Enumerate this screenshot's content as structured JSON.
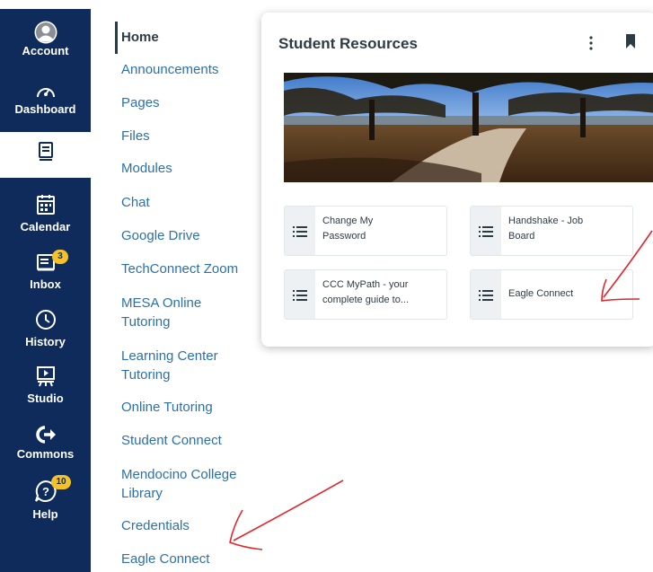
{
  "global_nav": {
    "account": "Account",
    "dashboard": "Dashboard",
    "calendar": "Calendar",
    "inbox": "Inbox",
    "inbox_badge": "3",
    "history": "History",
    "studio": "Studio",
    "commons": "Commons",
    "help": "Help",
    "help_badge": "10"
  },
  "course_nav": {
    "items": [
      "Home",
      "Announcements",
      "Pages",
      "Files",
      "Modules",
      "Chat",
      "Google Drive",
      "TechConnect Zoom",
      "MESA Online Tutoring",
      "Learning Center Tutoring",
      "Online Tutoring",
      "Student Connect",
      "Mendocino College Library",
      "Credentials",
      "Eagle Connect"
    ]
  },
  "card": {
    "title": "Student Resources",
    "tiles": [
      "Change My Password",
      "Handshake - Job Board",
      "CCC MyPath - your complete guide to...",
      "Eagle Connect"
    ]
  },
  "colors": {
    "nav_bg": "#0e2b5c",
    "link": "#2d70a8",
    "badge": "#f4c127",
    "arrow": "#e0262b"
  }
}
